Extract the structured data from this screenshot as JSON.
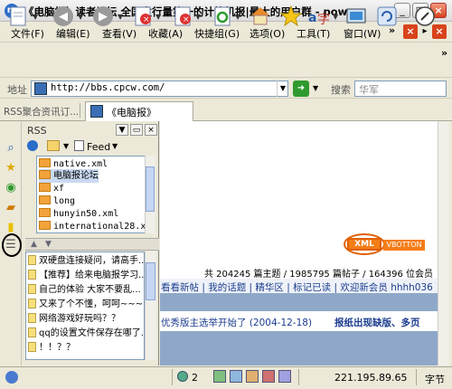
{
  "window": {
    "title": "《电脑报》读者论坛 全国发行量第一的计算机报|最大的用户群 - pow...",
    "app_icon_label": "m"
  },
  "menu": {
    "items": [
      "文件(F)",
      "编辑(E)",
      "查看(V)",
      "收藏(A)",
      "快捷组(G)",
      "选项(O)",
      "工具(T)",
      "窗口(W)"
    ],
    "overflow": "»"
  },
  "address": {
    "label": "地址",
    "url": "http://bbs.cpcw.com/",
    "search_label": "搜索",
    "search_value": "华军"
  },
  "tabbar": {
    "rss_label": "RSS聚合资讯订...",
    "active_tab": "《电脑报》"
  },
  "rss_panel": {
    "title": "RSS",
    "feed_label": "Feed",
    "feeds": [
      {
        "name": "native.xml",
        "selected": false
      },
      {
        "name": "电脑报论坛",
        "selected": true
      },
      {
        "name": "xf",
        "selected": false
      },
      {
        "name": "long",
        "selected": false
      },
      {
        "name": "hunyin50.xml",
        "selected": false
      },
      {
        "name": "international28.xml",
        "selected": false
      }
    ],
    "posts": [
      "双硬盘连接疑问，请高手...",
      "【推荐】给来电脑报学习...",
      "自己的体验  大家不要乱...",
      "又来了个不懂，呵呵~~~",
      "网络游戏好玩吗？？",
      "qq的设置文件保存在哪了...",
      "！！？？"
    ]
  },
  "content": {
    "xml_badge": "XML",
    "vbottom_badge": "VBOTTON",
    "stats": "共 204245 篇主题 / 1985795 篇帖子 / 164396 位会员",
    "nav": "看看新帖 | 我的话题 | 精华区 | 标记已读 | 欢迎新会员 hhhh036",
    "notice": "优秀版主选举开始了 (2004-12-18)",
    "notice_bold": "报纸出现缺版、多页"
  },
  "status": {
    "count": "2",
    "ip": "221.195.89.65",
    "encoding": "字节"
  }
}
